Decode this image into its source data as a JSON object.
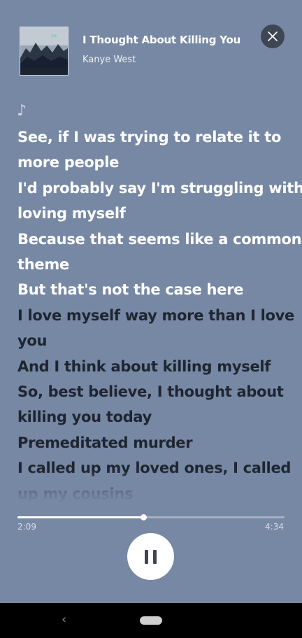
{
  "track": {
    "title": "I Thought About Killing You",
    "artist": "Kanye West"
  },
  "icons": {
    "close": "close-icon",
    "note": "music-note-icon",
    "pause": "pause-icon",
    "back": "nav-back-icon",
    "home": "nav-home-pill"
  },
  "note_glyph": "♪",
  "lyrics": [
    {
      "text": "See, if I was trying to relate it to",
      "state": "active"
    },
    {
      "text": "more people",
      "state": "active"
    },
    {
      "text": "I'd probably say I'm struggling with",
      "state": "active"
    },
    {
      "text": "loving myself",
      "state": "active"
    },
    {
      "text": "Because that seems like a common",
      "state": "active"
    },
    {
      "text": "theme",
      "state": "active"
    },
    {
      "text": "But that's not the case here",
      "state": "active"
    },
    {
      "text": "I love myself way more than I love",
      "state": "upcoming"
    },
    {
      "text": "you",
      "state": "upcoming"
    },
    {
      "text": "And I think about killing myself",
      "state": "upcoming"
    },
    {
      "text": "So, best believe, I thought about",
      "state": "upcoming"
    },
    {
      "text": "killing you today",
      "state": "upcoming"
    },
    {
      "text": "Premeditated murder",
      "state": "upcoming"
    },
    {
      "text": "I called up my loved ones, I called",
      "state": "upcoming"
    },
    {
      "text": "up my cousins",
      "state": "upcoming"
    }
  ],
  "playback": {
    "elapsed": "2:09",
    "total": "4:34",
    "progress_fraction": 0.471
  },
  "nav": {
    "back_glyph": "‹"
  },
  "colors": {
    "background": "#7688a4",
    "active_lyric": "#ffffff",
    "upcoming_lyric": "#1f2530",
    "close_button": "#3e4654"
  }
}
